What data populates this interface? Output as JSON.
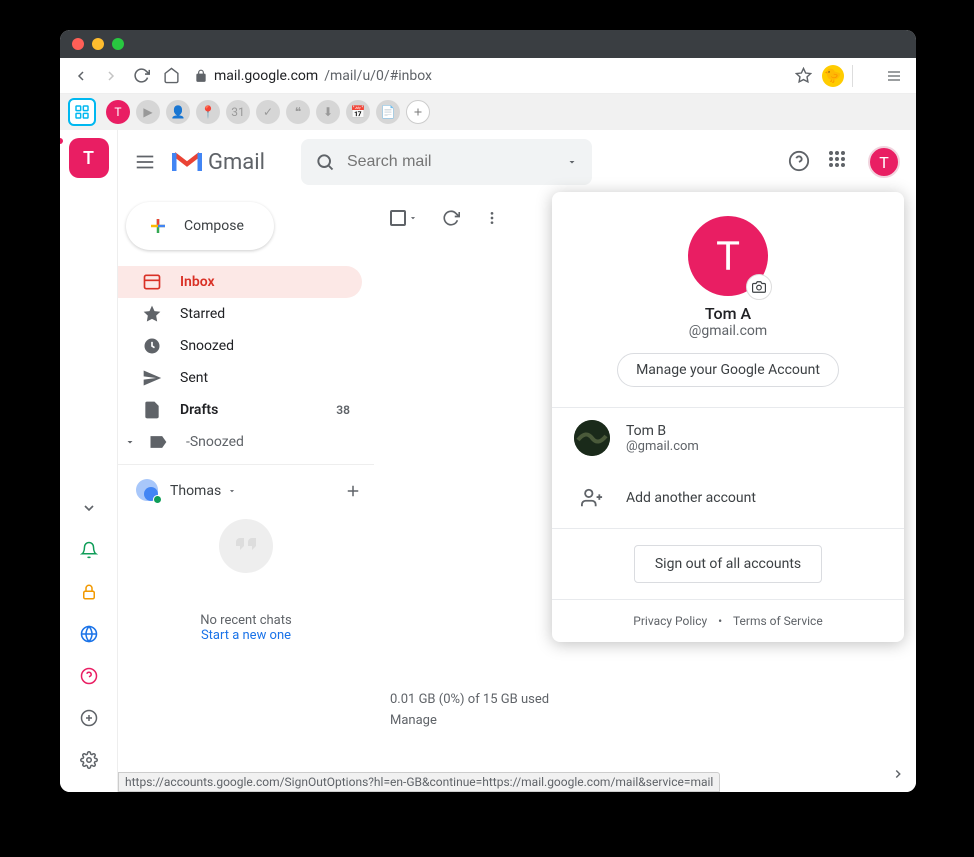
{
  "browser": {
    "url_domain": "mail.google.com",
    "url_path": "/mail/u/0/#inbox",
    "status_url": "https://accounts.google.com/SignOutOptions?hl=en-GB&continue=https://mail.google.com/mail&service=mail"
  },
  "leftrail": {
    "avatar_letter": "T"
  },
  "header": {
    "product": "Gmail",
    "search_placeholder": "Search mail",
    "avatar_letter": "T"
  },
  "compose_label": "Compose",
  "nav": {
    "inbox": "Inbox",
    "starred": "Starred",
    "snoozed": "Snoozed",
    "sent": "Sent",
    "drafts": "Drafts",
    "drafts_count": "38",
    "custom_label": "-Snoozed"
  },
  "hangouts": {
    "user": "Thomas",
    "empty": "No recent chats",
    "start": "Start a new one"
  },
  "storage": {
    "line1": "0.01 GB (0%) of 15 GB used",
    "manage": "Manage"
  },
  "account_popup": {
    "avatar_letter": "T",
    "name": "Tom A",
    "email": "@gmail.com",
    "manage": "Manage your Google Account",
    "other_name": "Tom B",
    "other_email": "@gmail.com",
    "add": "Add another account",
    "signout": "Sign out of all accounts",
    "privacy": "Privacy Policy",
    "terms": "Terms of Service"
  }
}
